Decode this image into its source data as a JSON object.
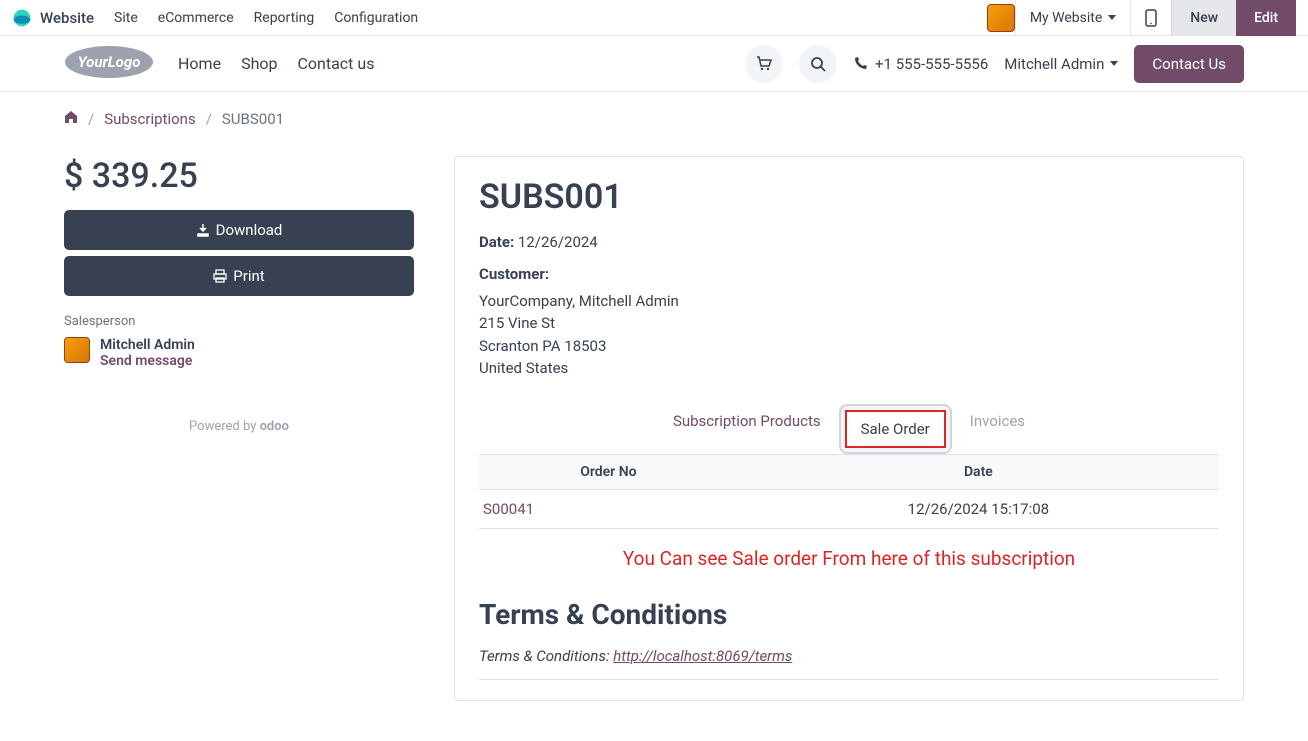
{
  "admin": {
    "title": "Website",
    "menu": [
      "Site",
      "eCommerce",
      "Reporting",
      "Configuration"
    ],
    "my_website": "My Website",
    "new": "New",
    "edit": "Edit"
  },
  "site": {
    "nav": [
      "Home",
      "Shop",
      "Contact us"
    ],
    "phone": "+1 555-555-5556",
    "user": "Mitchell Admin",
    "contact_btn": "Contact Us"
  },
  "breadcrumb": {
    "link1": "Subscriptions",
    "current": "SUBS001"
  },
  "sidebar": {
    "amount": "$ 339.25",
    "download": "Download",
    "print": "Print",
    "sp_label": "Salesperson",
    "sp_name": "Mitchell Admin",
    "sp_msg": "Send message",
    "powered": "Powered by",
    "powered_brand": "odoo"
  },
  "main": {
    "title": "SUBS001",
    "date_label": "Date:",
    "date_value": "12/26/2024",
    "customer_label": "Customer:",
    "customer_lines": [
      "YourCompany, Mitchell Admin",
      "215 Vine St",
      "Scranton PA 18503",
      "United States"
    ],
    "tabs": {
      "products": "Subscription Products",
      "sale_order": "Sale Order",
      "invoices": "Invoices"
    },
    "table": {
      "col_order": "Order No",
      "col_date": "Date",
      "rows": [
        {
          "order": "S00041",
          "date": "12/26/2024 15:17:08"
        }
      ]
    },
    "callout": "You Can see Sale order From here of this subscription",
    "terms_heading": "Terms & Conditions",
    "terms_prefix": "Terms & Conditions: ",
    "terms_url": "http://localhost:8069/terms"
  }
}
